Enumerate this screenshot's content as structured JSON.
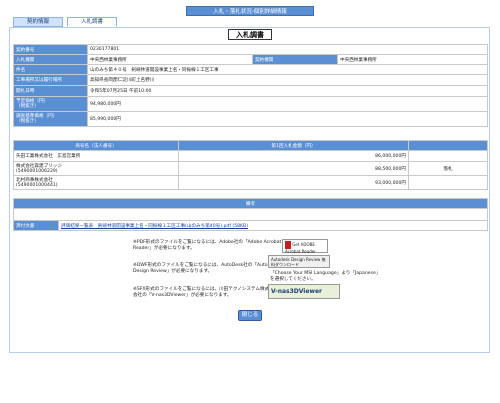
{
  "header": {
    "bar_title": "入札・落札状況-個別詳細情報",
    "tabs": [
      "契約情報",
      "入札調書"
    ],
    "page_title": "入札調書"
  },
  "details": [
    {
      "label": "契約番号",
      "value": "0230177801"
    },
    {
      "label": "入札機関",
      "value": "中央西林業事務所",
      "label2": "契約機関",
      "value2": "中央西林業事務所"
    },
    {
      "label": "件名",
      "value": "山のみち第４０号　剣峡林道開設事業上名・同振線１工区工事"
    },
    {
      "label": "工事場所又は履行場所",
      "value": "高知県長岡郡仁淀川町上名野川"
    },
    {
      "label": "開札日時",
      "value": "令和5年07月25日 午前10:00"
    },
    {
      "label": "予定価格（円）\n（税抜き）",
      "value": "94,980,000円"
    },
    {
      "label": "調査基準価格（円）\n（税抜き）",
      "value": "85,990,000円"
    }
  ],
  "bids": {
    "headers": [
      "商号名（法人番号）",
      "第1回入札金額（円）",
      ""
    ],
    "rows": [
      {
        "name": "矢田工業株式会社　広島営業所",
        "amount": "86,000,000円",
        "remark": ""
      },
      {
        "name": "株式会社森建ブリッジ\n(5490001006229)",
        "amount": "88,500,000円",
        "remark": "落札"
      },
      {
        "name": "北村商事株式会社\n(5490001000441)",
        "amount": "93,000,000円",
        "remark": ""
      }
    ]
  },
  "remarks": {
    "header": "備考",
    "attachment_label": "添付文書",
    "attachment_link": "評価結果一覧表　剣峡林道開設事業上名・同振線１工区工事(山のみち第40号).pdf (58KB)"
  },
  "notes": {
    "pdf": "※PDF形式のファイルをご覧になるには、Adobe社の「Adobe Acrobat Reader」が必要になります。",
    "dwf": "※DWF形式のファイルをご覧になるには、AutoDesk社の「AutoDesk Design Review」が必要になります。",
    "dwf2": "「Choose Your MSI Language」より「Japanese」を選択してください。",
    "sfx": "※SFX形式のファイルをご覧になるには、川田テクノシステム株式会社の「V-nas3DViewer」が必要になります。",
    "badge_adobe": "Get ADOBE Acrobat Reader",
    "badge_autodesk": "Autodesk Design Review 無料ダウンロード",
    "badge_vnas": "V-nas3DViewer"
  },
  "buttons": {
    "close": "閉じる"
  },
  "colors": {
    "accent": "#5b8fd3",
    "tab_bg": "#cfe2fb"
  }
}
